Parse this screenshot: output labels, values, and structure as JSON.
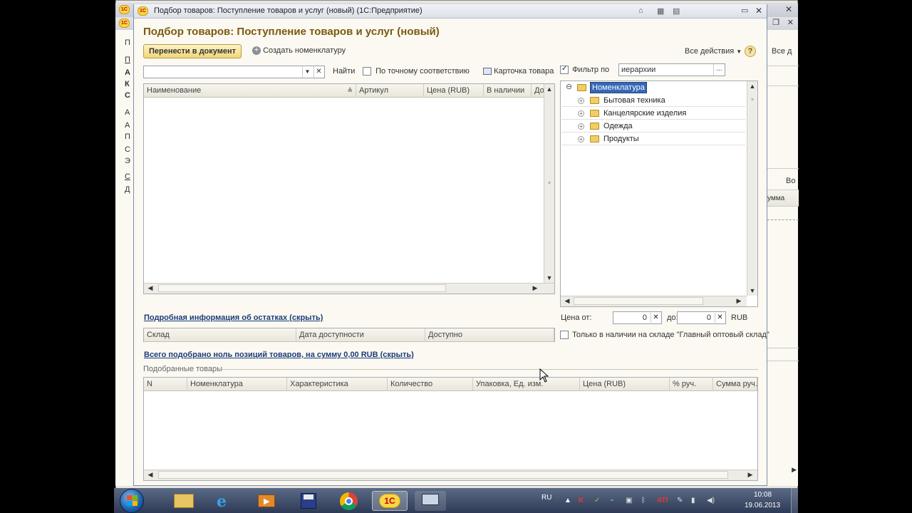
{
  "background_window": {
    "right_labels": [
      "Все д",
      "Во",
      "умма"
    ],
    "left_labels": [
      "П",
      "П",
      "А",
      "К",
      "С",
      "А",
      "А",
      "П",
      "С",
      "Э",
      "С",
      "Д"
    ]
  },
  "dialog": {
    "title": "Подбор товаров: Поступление товаров и услуг (новый)  (1С:Предприятие)",
    "heading": "Подбор товаров: Поступление товаров и услуг (новый)",
    "transfer_button": "Перенести в документ",
    "create_nomenclature": "Создать номенклатуру",
    "all_actions": "Все действия",
    "help": "?",
    "search": {
      "value": "",
      "find_label": "Найти"
    },
    "exact_match": {
      "label": "По точному соответствию",
      "checked": false
    },
    "product_card": "Карточка товара",
    "filter": {
      "label": "Фильтр по",
      "checked": true,
      "value": "иерархии"
    },
    "products_grid": {
      "columns": [
        "Наименование",
        "Артикул",
        "Цена (RUB)",
        "В наличии",
        "До"
      ]
    },
    "tree": {
      "root": "Номенклатура",
      "items": [
        "Бытовая техника",
        "Канцелярские изделия",
        "Одежда",
        "Продукты"
      ]
    },
    "stock_info_link": "Подробная информация об остатках (скрыть)",
    "stock_grid": {
      "columns": [
        "Склад",
        "Дата доступности",
        "Доступно"
      ]
    },
    "price_filter": {
      "from_label": "Цена от:",
      "from_value": "0",
      "to_label": "до:",
      "to_value": "0",
      "currency": "RUB"
    },
    "only_in_stock": {
      "label": "Только в наличии на складе \"Главный оптовый склад\"",
      "checked": false
    },
    "summary_link": "Всего подобрано ноль позиций товаров, на сумму 0,00 RUB (скрыть)",
    "selected_section_label": "Подобранные товары",
    "selected_grid": {
      "columns": [
        "N",
        "Номенклатура",
        "Характеристика",
        "Количество",
        "Упаковка, Ед. изм.",
        "Цена (RUB)",
        "% руч.",
        "Сумма руч."
      ]
    }
  },
  "taskbar": {
    "language": "RU",
    "time": "10:08",
    "date": "19.06.2013",
    "apps": [
      "start-button",
      "explorer",
      "internet-explorer",
      "media-player",
      "save-app",
      "chrome",
      "1c-enterprise",
      "remote-desktop"
    ]
  }
}
